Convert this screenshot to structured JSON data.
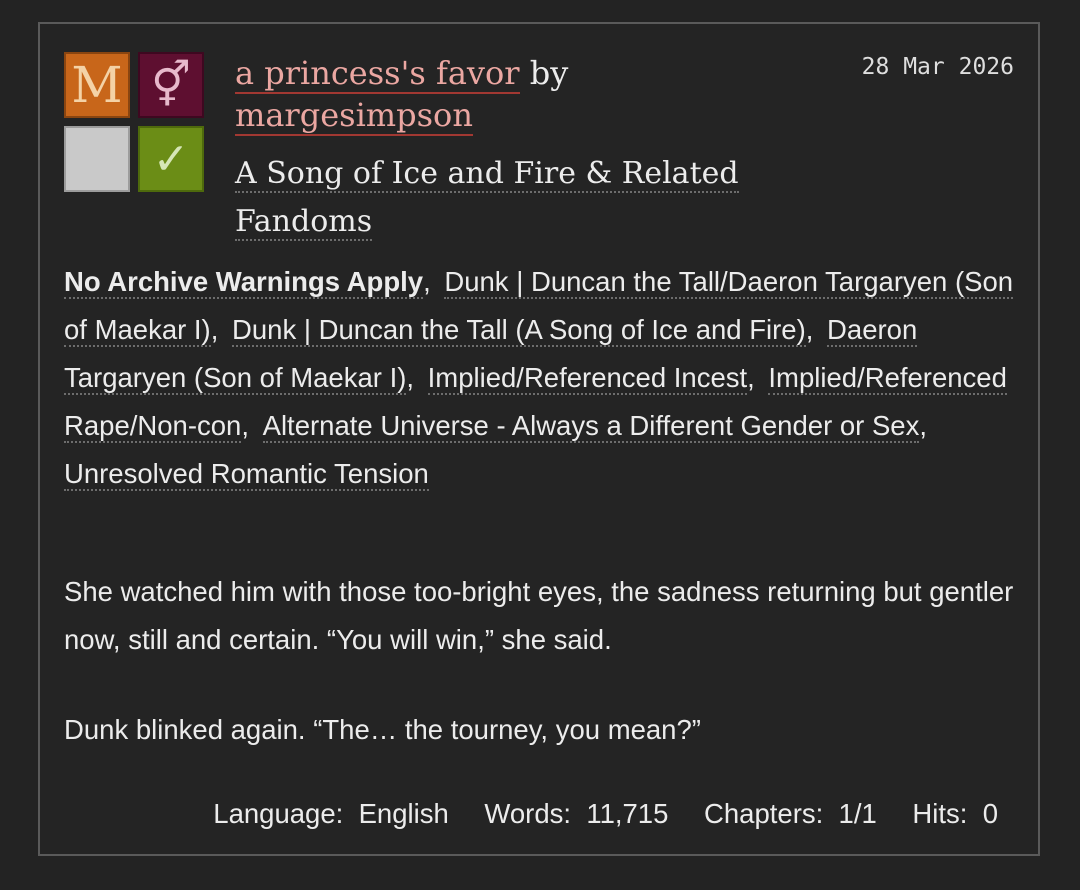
{
  "work": {
    "title": "a princess's favor",
    "by": "by",
    "author": "margesimpson",
    "fandom": "A Song of Ice and Fire & Related Fandoms",
    "date": "28 Mar 2026",
    "icons": {
      "rating": {
        "symbol": "M",
        "color": "#c8661a",
        "name": "rating-mature-icon"
      },
      "category": {
        "symbol": "⚥",
        "color": "#5e0f30",
        "name": "category-icon"
      },
      "warning": {
        "symbol": "",
        "color": "#c9c9c9",
        "name": "warning-icon"
      },
      "complete": {
        "symbol": "✓",
        "color": "#6b8d16",
        "name": "complete-icon"
      }
    },
    "tags": [
      "No Archive Warnings Apply",
      "Dunk | Duncan the Tall/Daeron Targaryen (Son of Maekar I)",
      "Dunk | Duncan the Tall (A Song of Ice and Fire)",
      "Daeron Targaryen (Son of Maekar I)",
      "Implied/Referenced Incest",
      "Implied/Referenced Rape/Non-con",
      "Alternate Universe - Always a Different Gender or Sex",
      "Unresolved Romantic Tension"
    ],
    "summary": [
      "She watched him with those too-bright eyes, the sadness returning but gentler now, still and certain. “You will win,” she said.",
      "Dunk blinked again. “The… the tourney, you mean?”"
    ],
    "stats": {
      "language_label": "Language:",
      "language": "English",
      "words_label": "Words:",
      "words": "11,715",
      "chapters_label": "Chapters:",
      "chapters": "1/1",
      "hits_label": "Hits:",
      "hits": "0"
    }
  }
}
